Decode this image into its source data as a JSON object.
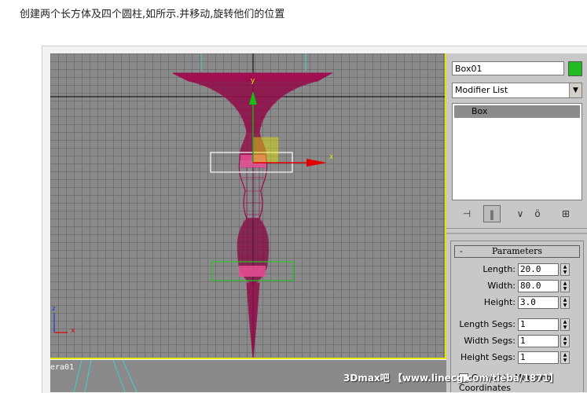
{
  "caption": "创建两个长方体及四个圆柱,如所示.并移动,旋转他们的位置",
  "viewport": {
    "axis_y_label": "y",
    "axis_x_label": "x",
    "corner_axis_z": "z",
    "corner_axis_x": "x"
  },
  "lower_viewport": {
    "label": "era01"
  },
  "panel": {
    "object_name": "Box01",
    "object_color": "#22bb22",
    "modifier_list": "Modifier List",
    "stack_item": "Box",
    "rollout_minus": "-",
    "rollout_title": "Parameters",
    "params": [
      {
        "label": "Length:",
        "value": "20.0"
      },
      {
        "label": "Width:",
        "value": "80.0"
      },
      {
        "label": "Height:",
        "value": "3.0"
      },
      {
        "label": "Length Segs:",
        "value": "1"
      },
      {
        "label": "Width Segs:",
        "value": "1"
      },
      {
        "label": "Height Segs:",
        "value": "1"
      }
    ],
    "genmap_label": "Generate Mapping Coordinates"
  },
  "icons": {
    "pin": "pin-stack-icon",
    "show_end": "show-end-result-icon",
    "unique": "make-unique-icon",
    "remove": "remove-modifier-icon",
    "configure": "configure-modifier-sets-icon"
  },
  "watermark": "3Dmax吧 【www.linecg.com/tieba/1871】",
  "colors": {
    "wireframe": "#9a0a4e",
    "selection_yellow": "#e6e600"
  }
}
